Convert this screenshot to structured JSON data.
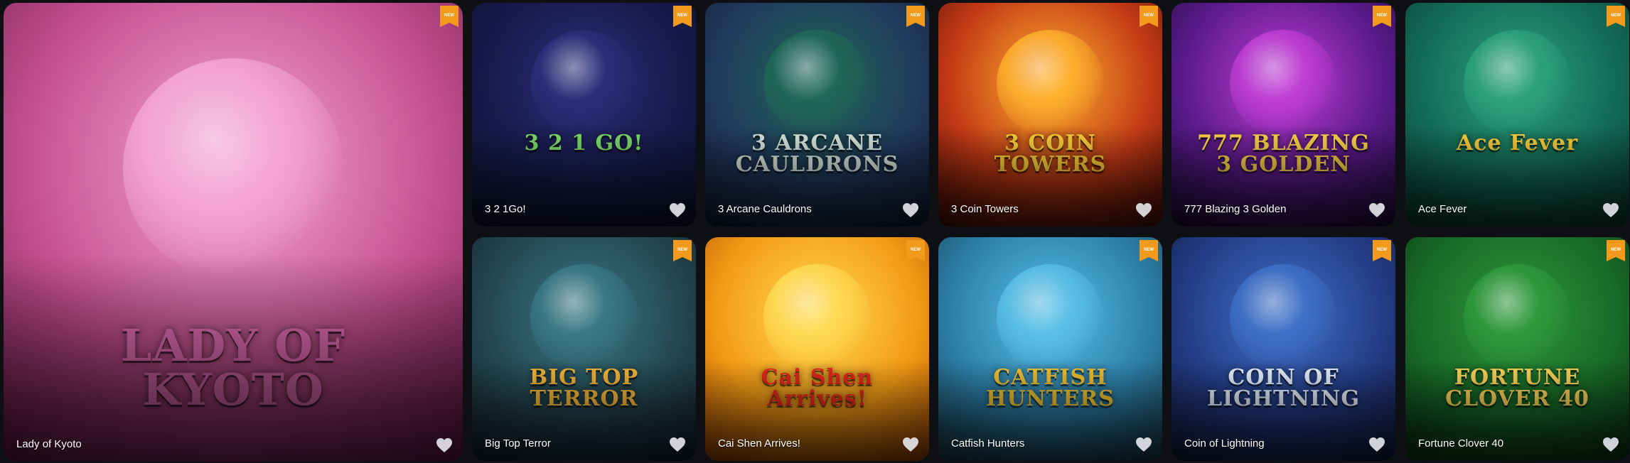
{
  "badge_label": "NEW",
  "games": [
    {
      "name": "Lady of Kyoto",
      "logo": "LADY OF KYOTO",
      "bg": [
        "#f6a8d8",
        "#c4508f",
        "#6a1748"
      ],
      "logo_color": "#e86fb8"
    },
    {
      "name": "3 2 1Go!",
      "logo": "3 2 1 GO!",
      "bg": [
        "#2a2f7a",
        "#171a4a",
        "#0f1130"
      ],
      "logo_color": "#7fe06a"
    },
    {
      "name": "3 Arcane Cauldrons",
      "logo": "3 ARCANE CAULDRONS",
      "bg": [
        "#1f6a55",
        "#213a5e",
        "#121a33"
      ],
      "logo_color": "#d9e9e1"
    },
    {
      "name": "3 Coin Towers",
      "logo": "3 COIN TOWERS",
      "bg": [
        "#ffb32e",
        "#c43a16",
        "#4a0c06"
      ],
      "logo_color": "#ffd23a"
    },
    {
      "name": "777 Blazing 3 Golden",
      "logo": "777 BLAZING 3 GOLDEN",
      "bg": [
        "#c23ed6",
        "#5a1a8a",
        "#1c0c38"
      ],
      "logo_color": "#ffd54a"
    },
    {
      "name": "Ace Fever",
      "logo": "Ace Fever",
      "bg": [
        "#2ea37d",
        "#126a54",
        "#0b3a2e"
      ],
      "logo_color": "#ffcf3a"
    },
    {
      "name": "Big Top Terror",
      "logo": "BIG TOP TERROR",
      "bg": [
        "#3a7a86",
        "#23454f",
        "#121f27"
      ],
      "logo_color": "#f6b73a"
    },
    {
      "name": "Cai Shen Arrives!",
      "logo": "Cai Shen Arrives!",
      "bg": [
        "#ffdc55",
        "#f49a14",
        "#a84a08"
      ],
      "logo_color": "#e8261c"
    },
    {
      "name": "Catfish Hunters",
      "logo": "CATFISH HUNTERS",
      "bg": [
        "#5ac1e8",
        "#2c7fa8",
        "#1a3d4c"
      ],
      "logo_color": "#f2c230"
    },
    {
      "name": "Coin of Lightning",
      "logo": "COIN OF LIGHTNING",
      "bg": [
        "#3f72c9",
        "#243c86",
        "#101a3e"
      ],
      "logo_color": "#e8f2ff"
    },
    {
      "name": "Fortune Clover 40",
      "logo": "FORTUNE CLOVER 40",
      "bg": [
        "#2f9a3c",
        "#186a28",
        "#0b3414"
      ],
      "logo_color": "#ffd65a"
    }
  ],
  "colors": {
    "badge": "#f39a1c",
    "heart": "#e9e9ee"
  }
}
